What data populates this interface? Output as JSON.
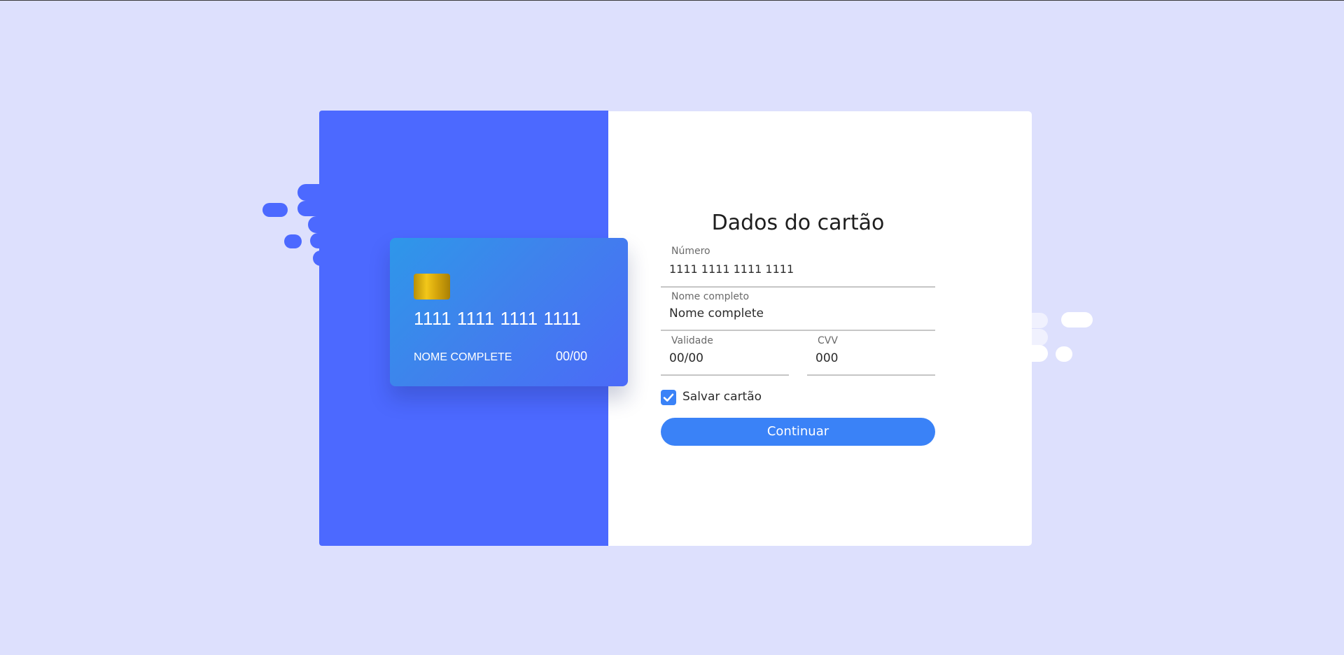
{
  "form": {
    "title": "Dados do cartão",
    "number": {
      "label": "Número",
      "value": "1111 1111 1111 1111"
    },
    "name": {
      "label": "Nome completo",
      "value": "Nome complete"
    },
    "expiry": {
      "label": "Validade",
      "value": "00/00"
    },
    "cvv": {
      "label": "CVV",
      "value": "000"
    },
    "save_card": {
      "label": "Salvar cartão",
      "checked": true
    },
    "submit_label": "Continuar"
  },
  "card": {
    "number": "1111 1111 1111 1111",
    "holder_name": "NOME COMPLETE",
    "expiry": "00/00"
  },
  "colors": {
    "background": "#dde0fd",
    "accent_blue": "#4c69ff",
    "button_blue": "#3a82f7"
  }
}
